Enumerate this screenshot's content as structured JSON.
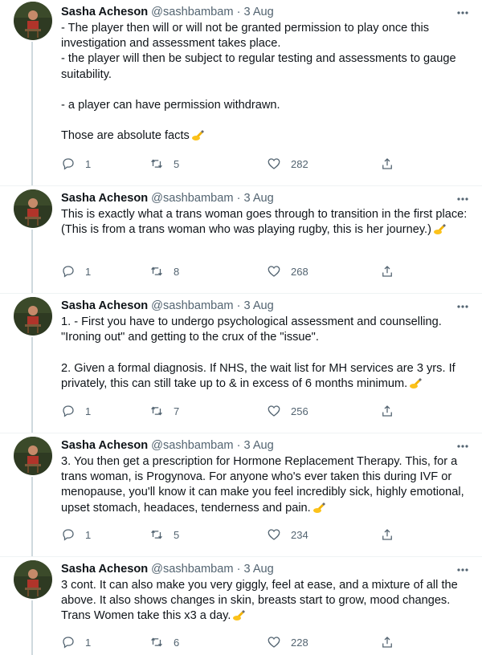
{
  "tweets": [
    {
      "name": "Sasha Acheson",
      "handle": "@sashbambam",
      "sep": "·",
      "date": "3 Aug",
      "text": "- The player then will or will not be granted permission to play once this investigation and assessment takes place.\n- the player will then be subject to regular testing and assessments to gauge suitability.\n\n- a player can have permission withdrawn.\n\nThose are absolute facts",
      "emoji": "writing-hand-icon",
      "replies": "1",
      "retweets": "5",
      "likes": "282"
    },
    {
      "name": "Sasha Acheson",
      "handle": "@sashbambam",
      "sep": "·",
      "date": "3 Aug",
      "text": "This is exactly what a trans woman goes through to transition in the first place: (This is from a trans woman who was playing rugby, this is her journey.)",
      "emoji": "writing-hand-icon",
      "replies": "1",
      "retweets": "8",
      "likes": "268"
    },
    {
      "name": "Sasha Acheson",
      "handle": "@sashbambam",
      "sep": "·",
      "date": "3 Aug",
      "text": "1. - First you have to undergo psychological assessment and counselling. \"Ironing out\" and getting to the crux of the \"issue\".\n\n2. Given a formal diagnosis. If NHS, the wait list for MH services are 3 yrs. If privately, this can still take up to & in excess of 6 months minimum.",
      "emoji": "writing-hand-icon",
      "replies": "1",
      "retweets": "7",
      "likes": "256"
    },
    {
      "name": "Sasha Acheson",
      "handle": "@sashbambam",
      "sep": "·",
      "date": "3 Aug",
      "text": "3. You then get a prescription for Hormone Replacement Therapy. This, for a trans woman, is Progynova. For anyone who's ever taken this during IVF or menopause, you'll know it can make you feel incredibly sick, highly emotional, upset stomach, headaces, tenderness and pain.",
      "emoji": "writing-hand-icon",
      "replies": "1",
      "retweets": "5",
      "likes": "234"
    },
    {
      "name": "Sasha Acheson",
      "handle": "@sashbambam",
      "sep": "·",
      "date": "3 Aug",
      "text": "3 cont. It can also make you very giggly, feel at ease, and a mixture of all the above. It also shows changes in skin, breasts start to grow, mood changes. Trans Women take this x3 a day.",
      "emoji": "writing-hand-icon",
      "replies": "1",
      "retweets": "6",
      "likes": "228"
    }
  ],
  "colors": {
    "text": "#0f1419",
    "secondary": "#536471",
    "thread_line": "#cfd9de",
    "divider": "#eff3f4",
    "emoji": "#f4b400"
  }
}
